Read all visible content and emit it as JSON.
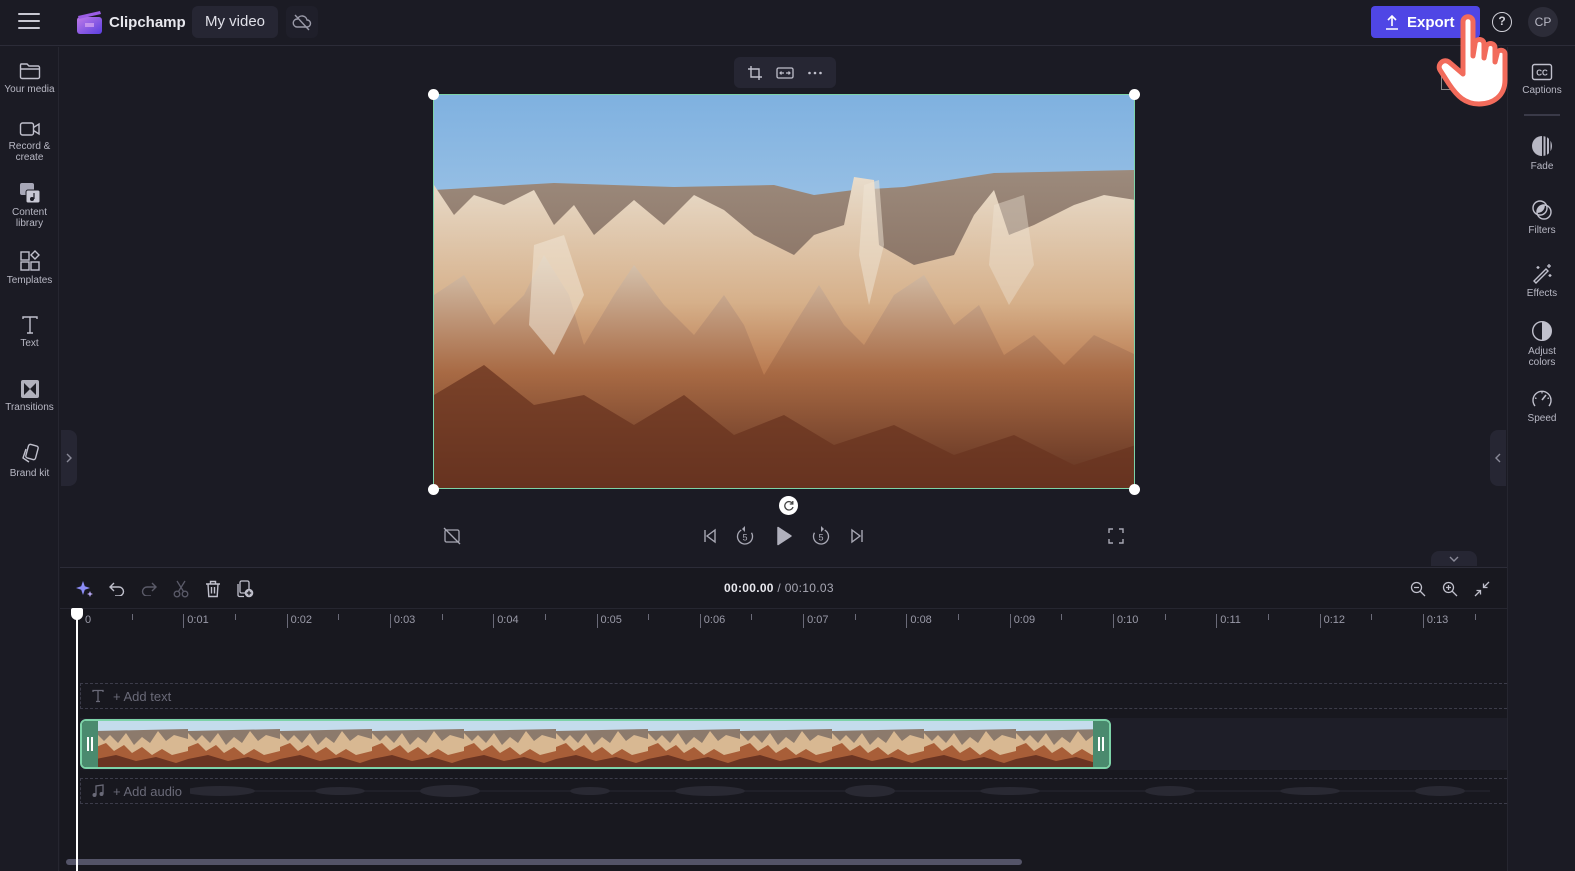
{
  "app": {
    "brand": "Clipchamp",
    "project_title": "My video",
    "export_label": "Export",
    "help_label": "?",
    "avatar_initials": "CP",
    "accent_color": "#4f46e5",
    "selection_color": "#7dd3a8"
  },
  "left_sidebar": {
    "items": [
      {
        "label": "Your media",
        "icon": "folder-icon"
      },
      {
        "label": "Record & create",
        "icon": "video-camera-icon"
      },
      {
        "label": "Content library",
        "icon": "content-library-icon"
      },
      {
        "label": "Templates",
        "icon": "templates-icon"
      },
      {
        "label": "Text",
        "icon": "text-icon"
      },
      {
        "label": "Transitions",
        "icon": "transitions-icon"
      },
      {
        "label": "Brand kit",
        "icon": "brand-kit-icon"
      }
    ]
  },
  "right_sidebar": {
    "items": [
      {
        "label": "Captions",
        "icon": "captions-icon"
      },
      {
        "label": "Fade",
        "icon": "fade-icon"
      },
      {
        "label": "Filters",
        "icon": "filters-icon"
      },
      {
        "label": "Effects",
        "icon": "effects-icon"
      },
      {
        "label": "Adjust colors",
        "icon": "adjust-colors-icon"
      },
      {
        "label": "Speed",
        "icon": "speed-icon"
      }
    ]
  },
  "preview": {
    "context_toolbar": [
      "crop-icon",
      "fit-icon",
      "more-icon"
    ],
    "playback_controls": [
      "skip-back-icon",
      "rewind-5-icon",
      "play-icon",
      "forward-5-icon",
      "skip-forward-icon"
    ],
    "rewind_seconds": "5",
    "forward_seconds": "5"
  },
  "timeline": {
    "current_time": "00:00.00",
    "separator": " / ",
    "total_time": "00:10.03",
    "ruler_labels": [
      "0",
      "0:01",
      "0:02",
      "0:03",
      "0:04",
      "0:05",
      "0:06",
      "0:07",
      "0:08",
      "0:09",
      "0:10",
      "0:11",
      "0:12",
      "0:13"
    ],
    "add_text_label": "+ Add text",
    "add_audio_label": "+ Add audio",
    "clip_thumbnail_count": 11
  }
}
